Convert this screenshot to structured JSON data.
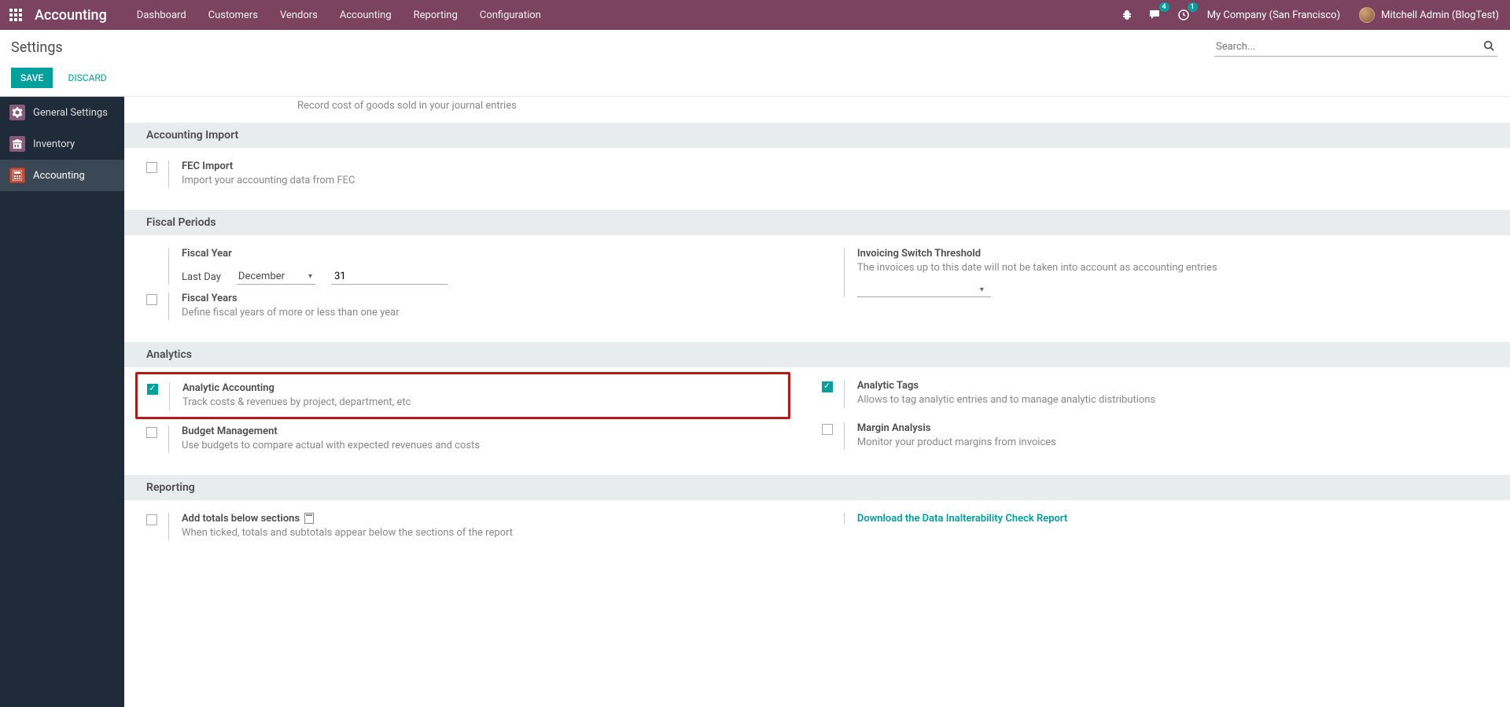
{
  "navbar": {
    "brand": "Accounting",
    "links": [
      "Dashboard",
      "Customers",
      "Vendors",
      "Accounting",
      "Reporting",
      "Configuration"
    ],
    "msg_badge": "4",
    "activity_badge": "1",
    "company": "My Company (San Francisco)",
    "user": "Mitchell Admin (BlogTest)"
  },
  "cp": {
    "title": "Settings",
    "search_placeholder": "Search..."
  },
  "actions": {
    "save": "SAVE",
    "discard": "DISCARD"
  },
  "sidebar": {
    "items": [
      {
        "label": "General Settings"
      },
      {
        "label": "Inventory"
      },
      {
        "label": "Accounting"
      }
    ]
  },
  "truncated": "Record cost of goods sold in your journal entries",
  "sections": {
    "import_header": "Accounting Import",
    "fec": {
      "title": "FEC Import",
      "desc": "Import your accounting data from FEC"
    },
    "fiscal_header": "Fiscal Periods",
    "fiscal_year": {
      "title": "Fiscal Year",
      "last_day_label": "Last Day",
      "month": "December",
      "day": "31"
    },
    "invoicing_threshold": {
      "title": "Invoicing Switch Threshold",
      "desc": "The invoices up to this date will not be taken into account as accounting entries"
    },
    "fiscal_years": {
      "title": "Fiscal Years",
      "desc": "Define fiscal years of more or less than one year"
    },
    "analytics_header": "Analytics",
    "analytic_acc": {
      "title": "Analytic Accounting",
      "desc": "Track costs & revenues by project, department, etc"
    },
    "analytic_tags": {
      "title": "Analytic Tags",
      "desc": "Allows to tag analytic entries and to manage analytic distributions"
    },
    "budget": {
      "title": "Budget Management",
      "desc": "Use budgets to compare actual with expected revenues and costs"
    },
    "margin": {
      "title": "Margin Analysis",
      "desc": "Monitor your product margins from invoices"
    },
    "reporting_header": "Reporting",
    "totals": {
      "title": "Add totals below sections",
      "desc": "When ticked, totals and subtotals appear below the sections of the report"
    },
    "download_report": "Download the Data Inalterability Check Report"
  }
}
